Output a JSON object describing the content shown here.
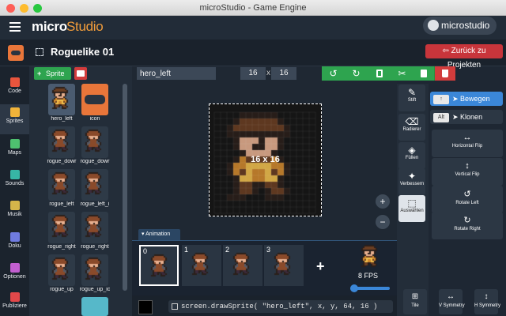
{
  "window": {
    "title": "microStudio - Game Engine"
  },
  "brand": {
    "part1": "micro",
    "part2": "Studio"
  },
  "user": {
    "name": "microstudio",
    "icon": "user-icon"
  },
  "project": {
    "title": "Roguelike 01",
    "back_label": "Zurück zu Projekten"
  },
  "sidebar": {
    "items": [
      {
        "label": "Code",
        "icon": "code-icon",
        "color": "#e8553d"
      },
      {
        "label": "Sprites",
        "icon": "image-icon",
        "color": "#f0b33a"
      },
      {
        "label": "Maps",
        "icon": "map-icon",
        "color": "#4ec06f"
      },
      {
        "label": "Sounds",
        "icon": "speaker-icon",
        "color": "#37b6a5"
      },
      {
        "label": "Musik",
        "icon": "music-icon",
        "color": "#d4b54a"
      },
      {
        "label": "Doku",
        "icon": "book-icon",
        "color": "#6f7be0"
      },
      {
        "label": "Optionen",
        "icon": "gear-icon",
        "color": "#c25fd0"
      },
      {
        "label": "Publiziere",
        "icon": "upload-icon",
        "color": "#e2484a"
      }
    ]
  },
  "sprites_panel": {
    "add_label": "Sprite",
    "items": [
      {
        "label": "hero_left"
      },
      {
        "label": "icon"
      },
      {
        "label": "rogue_dowr"
      },
      {
        "label": "rogue_dowr"
      },
      {
        "label": "rogue_left"
      },
      {
        "label": "rogue_left_i"
      },
      {
        "label": "rogue_right"
      },
      {
        "label": "rogue_right"
      },
      {
        "label": "rogue_up"
      },
      {
        "label": "rogue_up_ic"
      }
    ]
  },
  "editor": {
    "name": "hero_left",
    "width": "16",
    "x_sep": "x",
    "height": "16",
    "dimensions": "16 x 16"
  },
  "animation": {
    "tab_label": "Animation",
    "frames": [
      "0",
      "1",
      "2",
      "3"
    ],
    "fps": "8 FPS"
  },
  "code": {
    "text": "screen.drawSprite( \"hero_left\", x, y, 64, 16 )"
  },
  "tools": [
    {
      "label": "Stift",
      "icon": "pencil-icon"
    },
    {
      "label": "Radierer",
      "icon": "eraser-icon"
    },
    {
      "label": "Füllen",
      "icon": "fill-icon"
    },
    {
      "label": "Verbessern",
      "icon": "magic-icon"
    },
    {
      "label": "Auswählen",
      "icon": "select-icon"
    }
  ],
  "modes": {
    "move_key": "↑",
    "move_label": "Bewegen",
    "clone_key": "Alt",
    "clone_label": "Klonen"
  },
  "transforms": [
    {
      "label": "Horizontal Flip",
      "icon": "↔"
    },
    {
      "label": "Vertical Flip",
      "icon": "↕"
    },
    {
      "label": "Rotate Left",
      "icon": "↺"
    },
    {
      "label": "Rotate Right",
      "icon": "↻"
    }
  ],
  "bottom_tools": [
    {
      "label": "Tile",
      "icon": "⊞"
    },
    {
      "label": "V Symmetry",
      "icon": "↔"
    },
    {
      "label": "H Symmetry",
      "icon": "↕"
    }
  ],
  "colors": {
    "accent": "#2ea44f",
    "danger": "#d23c3c",
    "select": "#3b87d8"
  }
}
